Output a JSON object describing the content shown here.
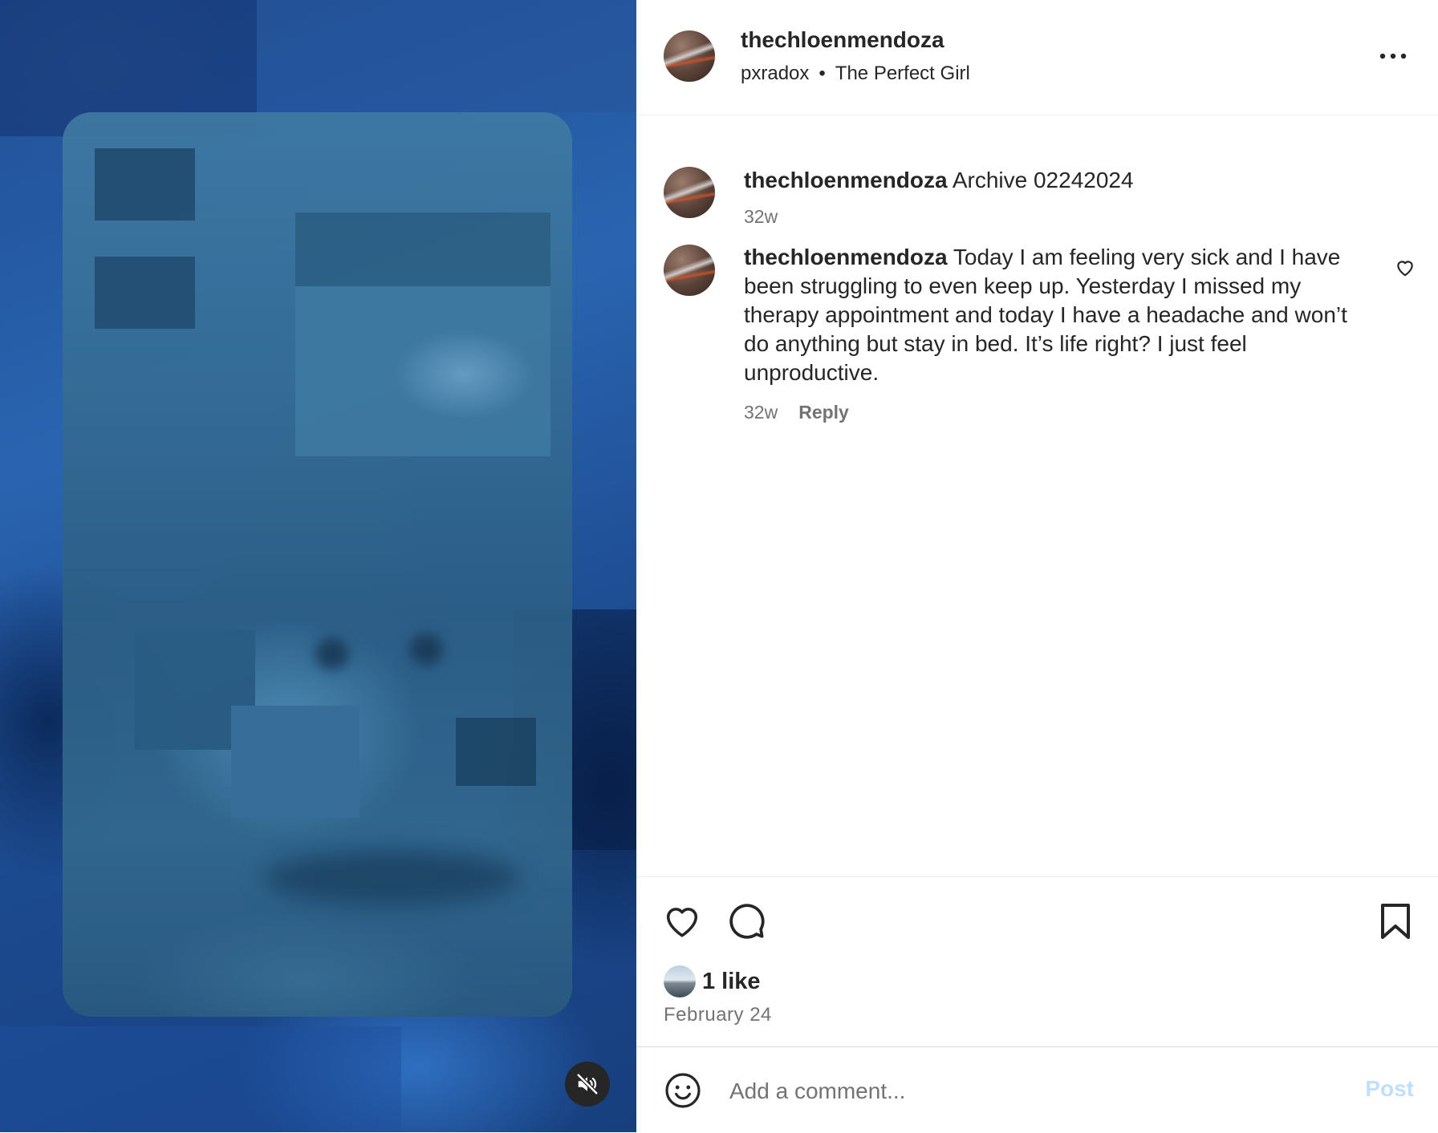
{
  "post": {
    "author": "thechloenmendoza",
    "audio_artist": "pxradox",
    "audio_separator": "•",
    "audio_track": "The Perfect Girl"
  },
  "comments": [
    {
      "username": "thechloenmendoza",
      "text": "Archive 02242024",
      "age": "32w"
    },
    {
      "username": "thechloenmendoza",
      "text": "Today I am feeling very sick and I have been struggling to even keep up. Yesterday I missed my therapy appointment and today I have a headache and won’t do anything but stay in bed. It’s life right? I just feel unproductive.",
      "age": "32w",
      "reply_label": "Reply"
    }
  ],
  "engagement": {
    "likes_count": "1 like",
    "date": "February 24"
  },
  "comment_box": {
    "placeholder": "Add a comment...",
    "post_label": "Post"
  },
  "icons": {
    "more": "more-options-icon",
    "like": "heart-icon",
    "comment": "comment-bubble-icon",
    "save": "bookmark-icon",
    "emoji": "emoji-icon",
    "mute": "speaker-muted-icon"
  },
  "colors": {
    "text_primary": "#262626",
    "text_secondary": "#737373",
    "post_disabled": "#c0dffd",
    "divider": "#efefef"
  }
}
